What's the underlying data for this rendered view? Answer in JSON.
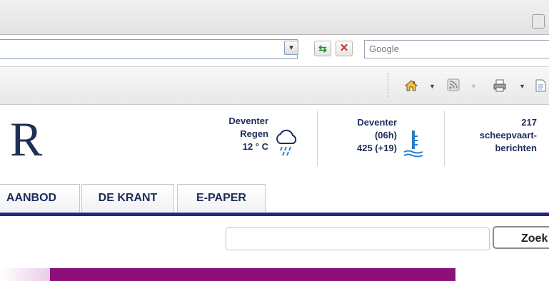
{
  "browser": {
    "search_placeholder": "Google"
  },
  "weather": {
    "city": "Deventer",
    "condition": "Regen",
    "temperature": "12 ° C"
  },
  "water": {
    "city": "Deventer",
    "time": "(06h)",
    "level": "425 (+19)"
  },
  "shipping": {
    "count": "217",
    "line1": "scheepvaart-",
    "line2": "berichten"
  },
  "nav": {
    "tabs": [
      {
        "label": "AANBOD"
      },
      {
        "label": "DE KRANT"
      },
      {
        "label": "E-PAPER"
      }
    ]
  },
  "site_search": {
    "button_label": "Zoek"
  },
  "colors": {
    "nav_line": "#1c2a80",
    "banner": "#8d0f79",
    "text_navy": "#1d2c5a"
  }
}
